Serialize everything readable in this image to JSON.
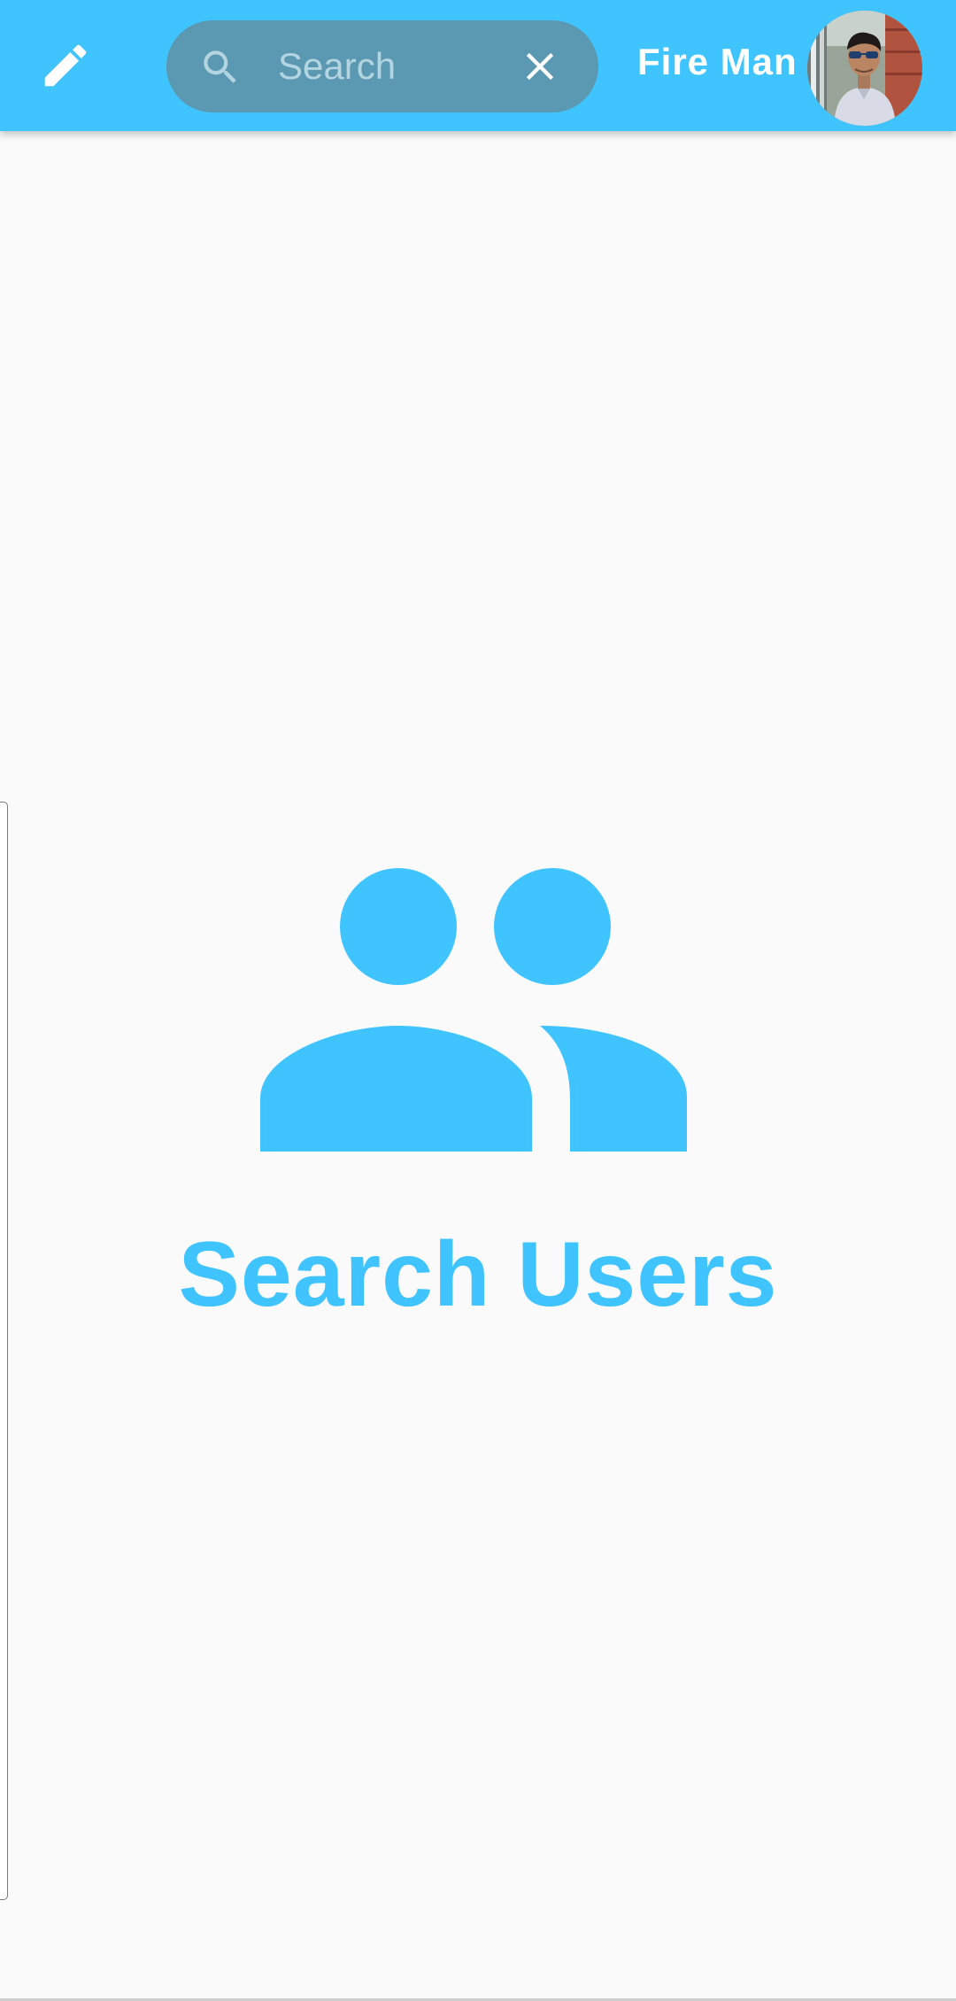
{
  "header": {
    "edit_icon": "pencil-icon",
    "search": {
      "icon": "search-icon",
      "placeholder": "Search",
      "value": "",
      "clear_icon": "close-icon"
    },
    "user_name": "Fire Man",
    "avatar_icon": "profile-photo"
  },
  "empty_state": {
    "icon": "people-icon",
    "title": "Search Users"
  },
  "colors": {
    "accent": "#40c4ff",
    "search_background": "#5b98b1",
    "background": "#fafafa"
  }
}
